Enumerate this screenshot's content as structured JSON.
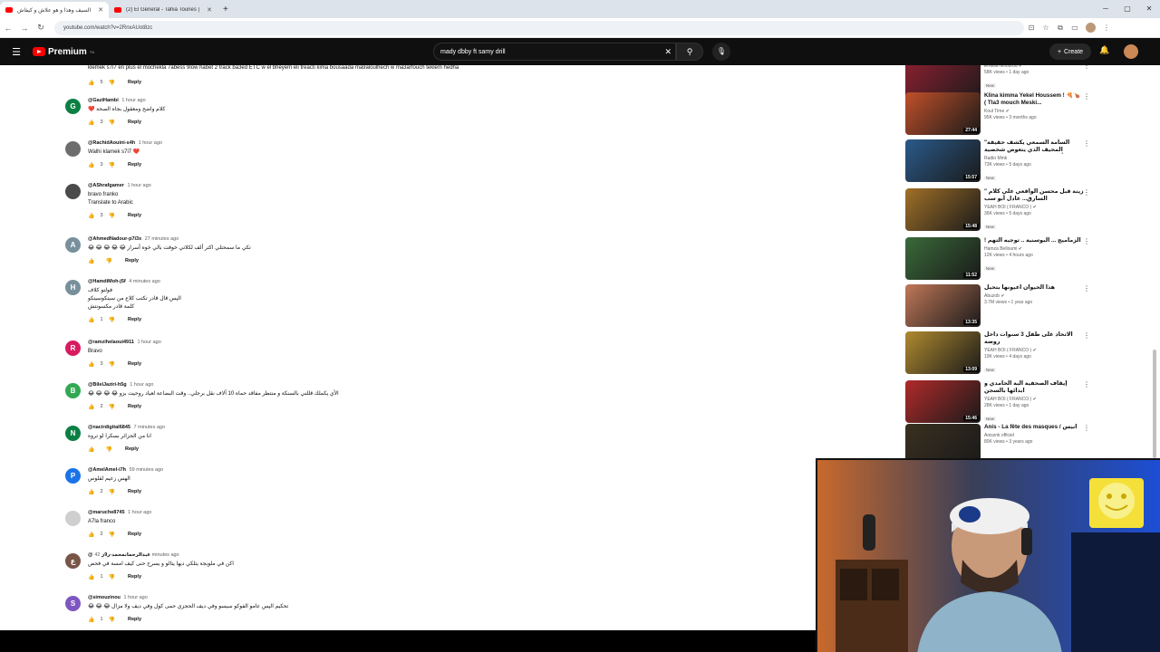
{
  "browser": {
    "tabs": [
      {
        "title": "السيف وهذا و هو علاش و كيفاش",
        "active": true
      },
      {
        "title": "(2) El General - Tahia Tounes |",
        "active": false
      }
    ],
    "url": "youtube.com/watch?v=2RnxAUot8zc"
  },
  "youtube": {
    "logo": "Premium",
    "logo_sup": "TN",
    "search_value": "mady dbby ft samy drill",
    "create_label": "Create"
  },
  "comments_top": {
    "text": "klemek s7i7 en plus el mochekla  7abess 9low habet 2 track ba3ed ETC  w el bhéyem eli treacti kima bousaada  ma9aloulhech w ma3arfouch  teklem hedha",
    "likes": "5",
    "reply": "Reply"
  },
  "comments": [
    {
      "avatar": "G",
      "color": "#0b8043",
      "handle": "@GaziHambi",
      "time": "1 hour ago",
      "lines": [
        "❤️ كلام واضح ومعقول بجاه الصحة"
      ],
      "likes": "3",
      "reply": "Reply"
    },
    {
      "avatar": "",
      "color": "#6d6d6d",
      "handle": "@RachidAouini-s4h",
      "time": "1 hour ago",
      "lines": [
        "Walhi klamek s7i7 ❤️"
      ],
      "likes": "3",
      "reply": "Reply"
    },
    {
      "avatar": "",
      "color": "#4a4a4a",
      "handle": "@AShrafgamer",
      "time": "1 hour ago",
      "lines": [
        "bravo franko",
        "Translate to Arabic"
      ],
      "likes": "3",
      "reply": "Reply"
    },
    {
      "avatar": "A",
      "color": "#78909c",
      "handle": "@AhmedNadour-p7i3x",
      "time": "27 minutes ago",
      "lines": [
        "😂 😂 😂 😂 😂 تكي ما سمحتلي اكثر ألف لكلاتي خوفت بالي خوه أسرار"
      ],
      "likes": "",
      "reply": "Reply"
    },
    {
      "avatar": "H",
      "color": "#78909c",
      "handle": "@HamdiMoh-j5f",
      "time": "4 minutes ago",
      "lines": [
        "فولتو كلاف",
        "الپس قال قادر تكتب كلاع من سينكوسينكو",
        "كلمة قادر مكسونتش"
      ],
      "likes": "1",
      "reply": "Reply"
    },
    {
      "avatar": "R",
      "color": "#d81b60",
      "handle": "@ramzihelaoui4911",
      "time": "1 hour ago",
      "lines": [
        "Bravo"
      ],
      "likes": "3",
      "reply": "Reply"
    },
    {
      "avatar": "B",
      "color": "#33a852",
      "handle": "@BilelJaziri-h5g",
      "time": "1 hour ago",
      "lines": [
        "😂 😂 😂 😂 الأي يكملك قللني بالسنكة و منتظر مفاقد حماه 10 آلاف نقل برجلي.. وقت البضاعة لعياد روحيت بزو"
      ],
      "likes": "2",
      "reply": "Reply"
    },
    {
      "avatar": "N",
      "color": "#0b8043",
      "handle": "@nacirdigital6845",
      "time": "7 minutes ago",
      "lines": [
        "انا من الجزائر بسكرا لو تروه"
      ],
      "likes": "",
      "reply": "Reply"
    },
    {
      "avatar": "P",
      "color": "#1a73e8",
      "handle": "@AmelAmel-i7h",
      "time": "59 minutes ago",
      "lines": [
        "الهس زعيم لقلوس"
      ],
      "likes": "2",
      "reply": "Reply"
    },
    {
      "avatar": "",
      "color": "#cfcfcf",
      "handle": "@maruche8745",
      "time": "1 hour ago",
      "lines": [
        "A7la franco"
      ],
      "likes": "2",
      "reply": "Reply"
    },
    {
      "avatar": "ع",
      "color": "#795548",
      "handle": "@عبدالرحمانمحمد-ر9ز",
      "time": "42 minutes ago",
      "lines": [
        "اكن في ملوبجة يتلكي ديها يتالو و يسرح حنى كيف امسة في فحص"
      ],
      "likes": "1",
      "reply": "Reply"
    },
    {
      "avatar": "S",
      "color": "#7e57c2",
      "handle": "@simouzinou",
      "time": "1 hour ago",
      "lines": [
        "😂 😂 😂 تحكيم الپس عامو الفوكو سيسو وفي ديف الحجزي حمى كول وفي ديف ولا مزال"
      ],
      "likes": "1",
      "reply": "Reply"
    }
  ],
  "sidebar_videos": [
    {
      "title": "",
      "channel": "Emwan Elfourou",
      "meta": "58K views • 1 day ago",
      "new": "New",
      "duration": "46:31",
      "tone": "#8a2030",
      "verified": true
    },
    {
      "title": "Klina kimma Yekel Houssem ! 🍕🍗 ( Tla3 mouch Meski...",
      "channel": "Koul Time",
      "meta": "95K views • 3 months ago",
      "new": "",
      "duration": "27:44",
      "tone": "#c1502a",
      "verified": true
    },
    {
      "title": "\"السامة السمعي يكشف حقيقة المحيف الذي يتعوض شخصية أسمحات المواقف في برنامج",
      "channel": "Radio Mmk",
      "meta": "73K views • 5 days ago",
      "new": "New",
      "duration": "15:57",
      "tone": "#2a5a8a",
      "verified": false
    },
    {
      "title": "\" زينة قبل محسن الواقعي على كلام السارق... عادل أبو سب",
      "channel": "YEAH BOI ( FRANCO )",
      "meta": "36K views • 5 days ago",
      "new": "New",
      "duration": "15:48",
      "tone": "#a07028",
      "verified": true
    },
    {
      "title": "! الزماميج ... البوسنية .. توجيه التهم",
      "channel": "Hamza Belloumi",
      "meta": "12K views • 4 hours ago",
      "new": "New",
      "duration": "11:52",
      "tone": "#3a6a3a",
      "verified": true
    },
    {
      "title": "هذا الحيوان اعيونها بتحيل",
      "channel": "Abuzob",
      "meta": "3.7M views • 1 year ago",
      "new": "",
      "duration": "13:35",
      "tone": "#c07858",
      "verified": true
    },
    {
      "title": "الاتحاد على طفل 3 سنوات داخل روضة",
      "channel": "YEAH BOI ( FRANCO )",
      "meta": "19K views • 4 days ago",
      "new": "New",
      "duration": "13:09",
      "tone": "#b08a30",
      "verified": true
    },
    {
      "title": "إيقاف الصحفية البة الحامدي و ابدائها بالسجن",
      "channel": "YEAH BOI ( FRANCO )",
      "meta": "28K views • 1 day ago",
      "new": "New",
      "duration": "15:46",
      "tone": "#b02a2a",
      "verified": true
    },
    {
      "title": "Anis - La fête des masques / أنيس",
      "channel": "Anisznk officiel",
      "meta": "80K views • 3 years ago",
      "new": "",
      "duration": "28:53",
      "tone": "#3a3020",
      "verified": false
    }
  ]
}
